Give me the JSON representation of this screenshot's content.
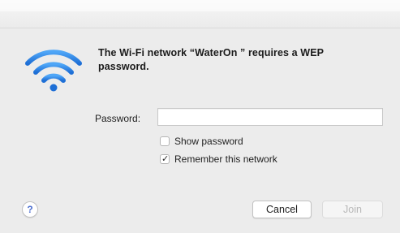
{
  "dialog": {
    "message_line1": "The Wi-Fi network “WaterOn        ” requires a WEP",
    "message_line2": "password.",
    "password_label": "Password:",
    "password_value": "",
    "show_password_label": "Show password",
    "show_password_checked": false,
    "remember_network_label": "Remember this network",
    "remember_network_checked": true,
    "check_glyph": "✓",
    "help_glyph": "?",
    "cancel_label": "Cancel",
    "join_label": "Join",
    "join_enabled": false
  },
  "icons": {
    "network": "wifi-icon",
    "help": "question-icon"
  },
  "colors": {
    "wifi_blue": "#2f86e6",
    "help_blue": "#4c6fcf",
    "disabled_text": "#b8b8b8"
  }
}
